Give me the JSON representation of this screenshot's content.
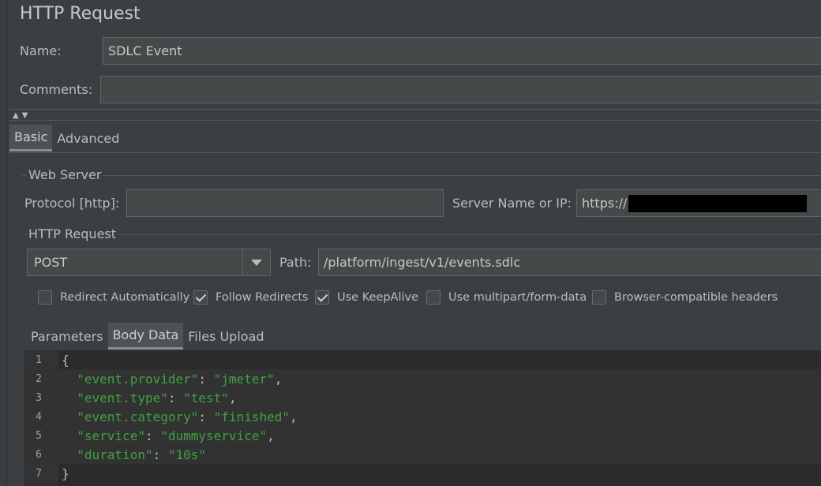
{
  "header": {
    "title": "HTTP Request"
  },
  "form": {
    "name_label": "Name:",
    "name_value": "SDLC Event",
    "comments_label": "Comments:",
    "comments_value": ""
  },
  "collapse_arrows": "▲▼",
  "tabs": [
    {
      "label": "Basic",
      "active": true
    },
    {
      "label": "Advanced",
      "active": false
    }
  ],
  "web_server": {
    "title": "Web Server",
    "protocol_label": "Protocol [http]:",
    "protocol_value": "",
    "server_label": "Server Name or IP:",
    "server_value": "https://"
  },
  "http_request": {
    "title": "HTTP Request",
    "method": "POST",
    "path_label": "Path:",
    "path_value": "/platform/ingest/v1/events.sdlc",
    "options": [
      {
        "label": "Redirect Automatically",
        "checked": false
      },
      {
        "label": "Follow Redirects",
        "checked": true
      },
      {
        "label": "Use KeepAlive",
        "checked": true
      },
      {
        "label": "Use multipart/form-data",
        "checked": false
      },
      {
        "label": "Browser-compatible headers",
        "checked": false
      }
    ]
  },
  "body_tabs": [
    {
      "label": "Parameters",
      "active": false
    },
    {
      "label": "Body Data",
      "active": true
    },
    {
      "label": "Files Upload",
      "active": false
    }
  ],
  "body_data": {
    "line_numbers": [
      "1",
      "2",
      "3",
      "4",
      "5",
      "6",
      "7"
    ],
    "lines": [
      {
        "segments": [
          {
            "text": "{",
            "kind": "punc"
          }
        ]
      },
      {
        "segments": [
          {
            "text": "  \"event.provider\"",
            "kind": "str"
          },
          {
            "text": ": ",
            "kind": "punc"
          },
          {
            "text": "\"jmeter\"",
            "kind": "str"
          },
          {
            "text": ",",
            "kind": "punc"
          }
        ]
      },
      {
        "segments": [
          {
            "text": "  \"event.type\"",
            "kind": "str"
          },
          {
            "text": ": ",
            "kind": "punc"
          },
          {
            "text": "\"test\"",
            "kind": "str"
          },
          {
            "text": ",",
            "kind": "punc"
          }
        ]
      },
      {
        "segments": [
          {
            "text": "  \"event.category\"",
            "kind": "str"
          },
          {
            "text": ": ",
            "kind": "punc"
          },
          {
            "text": "\"finished\"",
            "kind": "str"
          },
          {
            "text": ",",
            "kind": "punc"
          }
        ]
      },
      {
        "segments": [
          {
            "text": "  \"service\"",
            "kind": "str"
          },
          {
            "text": ": ",
            "kind": "punc"
          },
          {
            "text": "\"dummyservice\"",
            "kind": "str"
          },
          {
            "text": ",",
            "kind": "punc"
          }
        ]
      },
      {
        "segments": [
          {
            "text": "  \"duration\"",
            "kind": "str"
          },
          {
            "text": ": ",
            "kind": "punc"
          },
          {
            "text": "\"10s\"",
            "kind": "str"
          }
        ]
      },
      {
        "segments": [
          {
            "text": "}",
            "kind": "punc"
          }
        ]
      }
    ]
  }
}
